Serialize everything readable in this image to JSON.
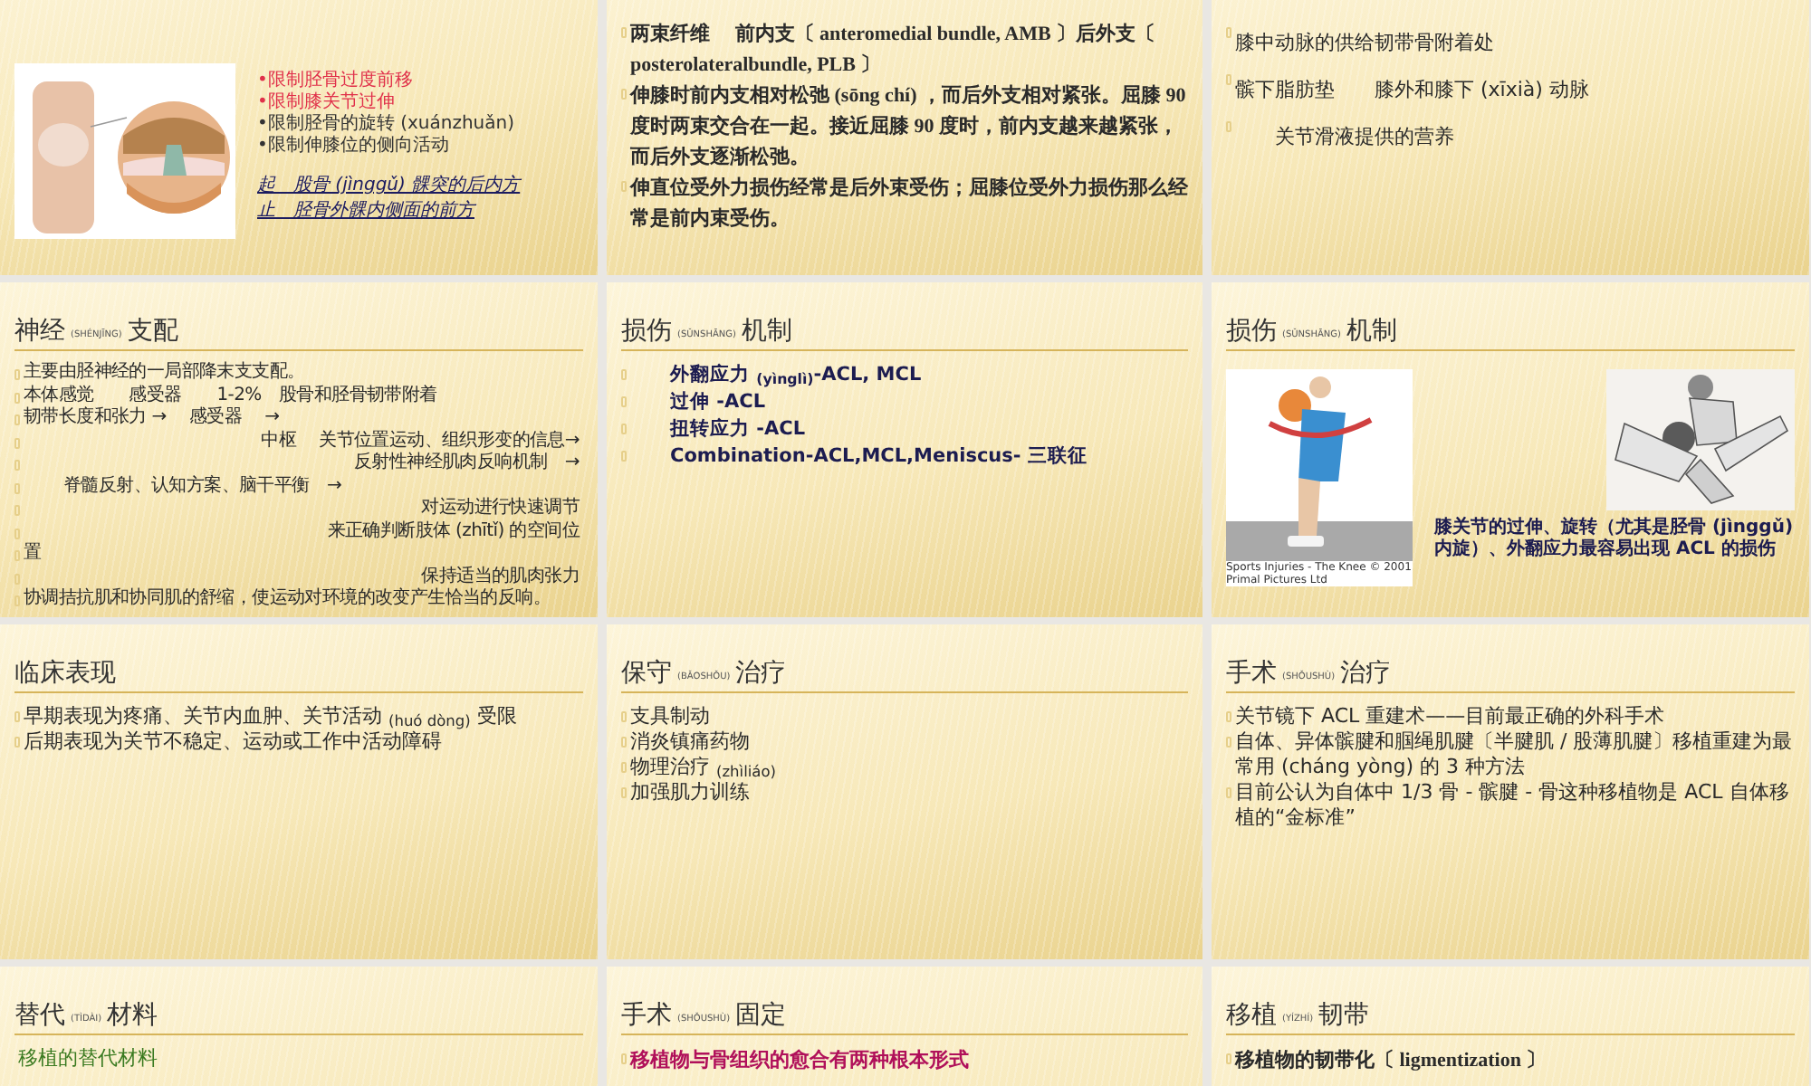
{
  "slides": [
    {
      "kind": "figure_notes",
      "notes": [
        {
          "text": "•限制胫骨过度前移",
          "color": "#e0304a"
        },
        {
          "text": "•限制膝关节过伸",
          "color": "#e0304a"
        },
        {
          "text": "•限制胫骨的旋转 (xuánzhuǎn)",
          "color": "#333333"
        },
        {
          "text": "•限制伸膝位的侧向活动",
          "color": "#333333"
        }
      ],
      "attachments": [
        "起　股骨 (jìnggǔ) 髁突的后内方",
        "止　胫骨外髁内侧面的前方"
      ]
    },
    {
      "kind": "serif_bullets",
      "items": [
        {
          "text": "两束纤维　 前内支〔 anteromedial bundle, AMB 〕后外支〔 posterolateralbundle, PLB 〕",
          "kind": "plain"
        },
        {
          "text": "伸膝时前内支相对松弛 (sōng chí) ，而后外支相对紧张。屈膝 90 度时两束交合在一起。接近屈膝 90 度时，前内支越来越紧张，而后外支逐渐松弛。",
          "kind": "plain"
        },
        {
          "text": "伸直位受外力损伤经常是后外束受伤；屈膝位受外力损伤那么经常是前内束受伤。",
          "kind": "plain"
        }
      ]
    },
    {
      "kind": "loose_bullets",
      "items": [
        {
          "text": "膝中动脉的供给韧带骨附着处",
          "kind": "plain"
        },
        {
          "text": "髌下脂肪垫　　膝外和膝下 (xīxià) 动脉",
          "kind": "plain"
        },
        {
          "text": "关节滑液提供的营养",
          "kind": "indented"
        }
      ]
    },
    {
      "kind": "small_bullets",
      "title": {
        "text": "神经",
        "pinyin": "(SHÉNJĪNG)",
        "suffix": "支配"
      },
      "items": [
        {
          "text": "主要由胫神经的一局部降末支支配。",
          "kind": "plain"
        },
        {
          "text": "本体感觉　　感受器　　1-2%　股骨和胫骨韧带附着",
          "kind": "plain"
        },
        {
          "text": "韧带长度和张力 →　 感受器　 →",
          "kind": "plain"
        },
        {
          "text": "中枢　 关节位置运动、组织形变的信息→",
          "kind": "trailing"
        },
        {
          "text": "反射性神经肌肉反响机制　→",
          "kind": "trailing"
        },
        {
          "text": "脊髓反射、认知方案、脑干平衡　→",
          "kind": "indented"
        },
        {
          "text": "对运动进行快速调节",
          "kind": "trailing"
        },
        {
          "text": "来正确判断肢体 (zhītǐ) 的空间位",
          "kind": "trailing"
        },
        {
          "text": "置",
          "kind": "plain"
        },
        {
          "text": "保持适当的肌肉张力",
          "kind": "trailing"
        },
        {
          "text": "协调拮抗肌和协同肌的舒缩，使运动对环境的改变产生恰当的反响。",
          "kind": "plain"
        }
      ]
    },
    {
      "kind": "bold_bullets",
      "title": {
        "text": "损伤",
        "pinyin": "(SǓNSHĀNG)",
        "suffix": "机制"
      },
      "items": [
        {
          "text": "外翻应力 $_{(yìnglì)}$-ACL, MCL",
          "kind": "indented"
        },
        {
          "text": "过伸 -ACL",
          "kind": "indented"
        },
        {
          "text": "扭转应力 -ACL",
          "kind": "indented"
        },
        {
          "text": "Combination-ACL,MCL,Meniscus- 三联征",
          "kind": "indented"
        }
      ]
    },
    {
      "kind": "figures",
      "title": {
        "text": "损伤",
        "pinyin": "(SǓNSHĀNG)",
        "suffix": "机制"
      },
      "credit": "Sports Injuries - The Knee © 2001 Primal Pictures Ltd",
      "caption": "膝关节的过伸、旋转（尤其是胫骨 (jìnggǔ) 内旋）、外翻应力最容易出现 ACL 的损伤"
    },
    {
      "kind": "sans_bullets",
      "title": {
        "text": "临床表现"
      },
      "items": [
        {
          "text": "早期表现为疼痛、关节内血肿、关节活动 $_{(huó dòng)}$ 受限",
          "kind": "plain"
        },
        {
          "text": "后期表现为关节不稳定、运动或工作中活动障碍",
          "kind": "plain"
        }
      ]
    },
    {
      "kind": "sans_bullets",
      "title": {
        "text": "保守",
        "pinyin": "(BǍOSHǑU)",
        "suffix": "治疗"
      },
      "items": [
        {
          "text": "支具制动",
          "kind": "plain"
        },
        {
          "text": "消炎镇痛药物",
          "kind": "plain"
        },
        {
          "text": "物理治疗 $_{(zhìliáo)}$",
          "kind": "plain"
        },
        {
          "text": "加强肌力训练",
          "kind": "plain"
        }
      ]
    },
    {
      "kind": "sans_bullets",
      "title": {
        "text": "手术",
        "pinyin": "(SHǑUSHÙ)",
        "suffix": "治疗"
      },
      "items": [
        {
          "text": "关节镜下 ACL 重建术——目前最正确的外科手术",
          "kind": "plain"
        },
        {
          "text": "自体、异体髌腱和腘绳肌腱〔半腱肌 / 股薄肌腱〕移植重建为最常用 (cháng yòng) 的 3 种方法",
          "kind": "plain"
        },
        {
          "text": "目前公认为自体中 1/3 骨 - 髌腱 - 骨这种移植物是 ACL 自体移植的“金标准”",
          "kind": "plain"
        }
      ]
    },
    {
      "kind": "sans_lines",
      "title": {
        "text": "替代",
        "pinyin": "(TÌDÀI)",
        "suffix": "材料"
      },
      "items": [
        {
          "text": "移植的替代材料",
          "kind": "plain",
          "color": "#3a7a20"
        }
      ]
    },
    {
      "kind": "serif_bullets",
      "title": {
        "text": "手术",
        "pinyin": "(SHǑUSHÙ)",
        "suffix": "固定"
      },
      "items": [
        {
          "text": "移植物与骨组织的愈合有两种根本形式",
          "kind": "plain",
          "color": "#b0105a"
        }
      ]
    },
    {
      "kind": "serif_bullets",
      "title": {
        "text": "移植",
        "pinyin": "(YÍZHÍ)",
        "suffix": "韧带"
      },
      "items": [
        {
          "text": "移植物的韧带化〔 ligmentization 〕",
          "kind": "plain"
        }
      ]
    }
  ]
}
